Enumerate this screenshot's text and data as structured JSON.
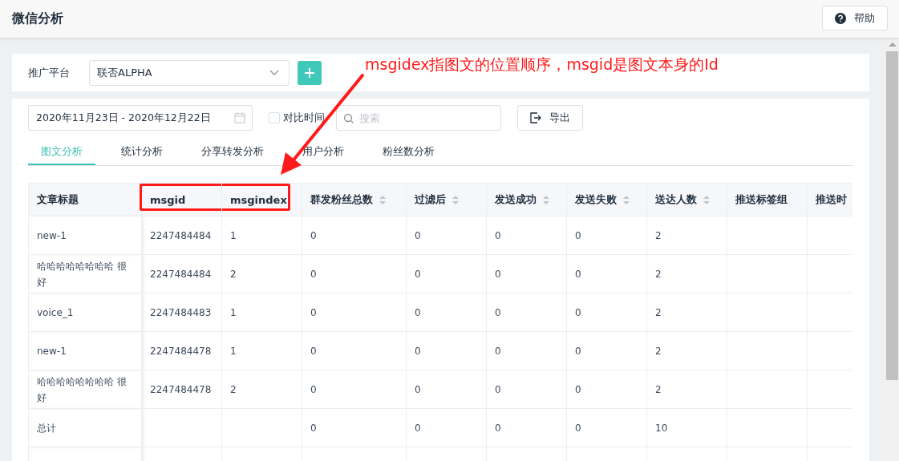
{
  "header": {
    "title": "微信分析",
    "help_button": "帮助"
  },
  "platform": {
    "label": "推广平台",
    "value": "联否ALPHA"
  },
  "toolbar": {
    "date_range": "2020年11月23日 - 2020年12月22日",
    "compare": {
      "label": "对比时间",
      "checked": false
    },
    "search": {
      "placeholder": "搜索"
    },
    "export_button": "导出"
  },
  "tabs": [
    {
      "label": "图文分析",
      "selected": true
    },
    {
      "label": "统计分析",
      "selected": false
    },
    {
      "label": "分享转发分析",
      "selected": false
    },
    {
      "label": "用户分析",
      "selected": false
    },
    {
      "label": "粉丝数分析",
      "selected": false
    }
  ],
  "table": {
    "columns": [
      {
        "label": "文章标题",
        "sortable": false,
        "highlighted": false
      },
      {
        "label": "msgid",
        "sortable": false,
        "highlighted": true
      },
      {
        "label": "msgindex",
        "sortable": false,
        "highlighted": true
      },
      {
        "label": "群发粉丝总数",
        "sortable": true,
        "highlighted": false
      },
      {
        "label": "过滤后",
        "sortable": true,
        "highlighted": false
      },
      {
        "label": "发送成功",
        "sortable": true,
        "highlighted": false
      },
      {
        "label": "发送失败",
        "sortable": true,
        "highlighted": false
      },
      {
        "label": "送达人数",
        "sortable": true,
        "highlighted": false
      },
      {
        "label": "推送标签组",
        "sortable": false,
        "highlighted": false
      },
      {
        "label": "推送时",
        "sortable": false,
        "highlighted": false
      }
    ],
    "rows": [
      [
        "new-1",
        "2247484484",
        "1",
        "0",
        "0",
        "0",
        "0",
        "2"
      ],
      [
        "哈哈哈哈哈哈哈哈 很好",
        "2247484484",
        "2",
        "0",
        "0",
        "0",
        "0",
        "2"
      ],
      [
        "voice_1",
        "2247484483",
        "1",
        "0",
        "0",
        "0",
        "0",
        "2"
      ],
      [
        "new-1",
        "2247484478",
        "1",
        "0",
        "0",
        "0",
        "0",
        "2"
      ],
      [
        "哈哈哈哈哈哈哈哈 很好",
        "2247484478",
        "2",
        "0",
        "0",
        "0",
        "0",
        "2"
      ],
      [
        "总计",
        "",
        "",
        "0",
        "0",
        "0",
        "0",
        "10"
      ]
    ]
  },
  "annotation": {
    "text": "msgidex指图文的位置顺序，msgid是图文本身的Id"
  }
}
